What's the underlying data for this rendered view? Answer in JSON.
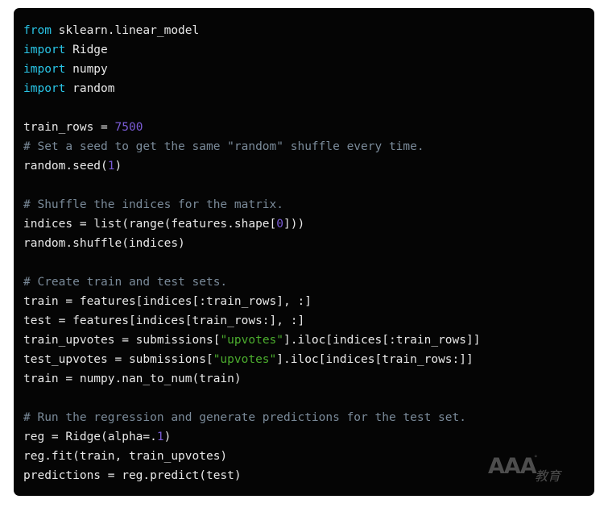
{
  "panel": {
    "background_color": "#050505",
    "language": "python"
  },
  "theme": {
    "background": "#050505",
    "plain_text": "#e8e8e8",
    "keyword": "#29c5e6",
    "number": "#7b5cd6",
    "string": "#4cad2e",
    "comment": "#7a8a99"
  },
  "watermark": {
    "logo_text": "AAA",
    "degree_mark": "°",
    "cjk_text": "教育"
  },
  "code": {
    "lines": [
      [
        {
          "t": "from",
          "c": "kw"
        },
        {
          "t": " sklearn.linear_model",
          "c": "pln"
        }
      ],
      [
        {
          "t": "import",
          "c": "kw"
        },
        {
          "t": " Ridge",
          "c": "pln"
        }
      ],
      [
        {
          "t": "import",
          "c": "kw"
        },
        {
          "t": " numpy",
          "c": "pln"
        }
      ],
      [
        {
          "t": "import",
          "c": "kw"
        },
        {
          "t": " random",
          "c": "pln"
        }
      ],
      [],
      [
        {
          "t": "train_rows = ",
          "c": "pln"
        },
        {
          "t": "7500",
          "c": "num"
        }
      ],
      [
        {
          "t": "# Set a seed to get the same \"random\" shuffle every time.",
          "c": "com"
        }
      ],
      [
        {
          "t": "random.seed(",
          "c": "pln"
        },
        {
          "t": "1",
          "c": "num"
        },
        {
          "t": ")",
          "c": "pln"
        }
      ],
      [],
      [
        {
          "t": "# Shuffle the indices for the matrix.",
          "c": "com"
        }
      ],
      [
        {
          "t": "indices = list(range(features.shape[",
          "c": "pln"
        },
        {
          "t": "0",
          "c": "num"
        },
        {
          "t": "]))",
          "c": "pln"
        }
      ],
      [
        {
          "t": "random.shuffle(indices)",
          "c": "pln"
        }
      ],
      [],
      [
        {
          "t": "# Create train and test sets.",
          "c": "com"
        }
      ],
      [
        {
          "t": "train = features[indices[:train_rows], :]",
          "c": "pln"
        }
      ],
      [
        {
          "t": "test = features[indices[train_rows:], :]",
          "c": "pln"
        }
      ],
      [
        {
          "t": "train_upvotes = submissions[",
          "c": "pln"
        },
        {
          "t": "\"upvotes\"",
          "c": "str"
        },
        {
          "t": "].iloc[indices[:train_rows]]",
          "c": "pln"
        }
      ],
      [
        {
          "t": "test_upvotes = submissions[",
          "c": "pln"
        },
        {
          "t": "\"upvotes\"",
          "c": "str"
        },
        {
          "t": "].iloc[indices[train_rows:]]",
          "c": "pln"
        }
      ],
      [
        {
          "t": "train = numpy.nan_to_num(train)",
          "c": "pln"
        }
      ],
      [],
      [
        {
          "t": "# Run the regression and generate predictions for the test set.",
          "c": "com"
        }
      ],
      [
        {
          "t": "reg = Ridge(alpha=.",
          "c": "pln"
        },
        {
          "t": "1",
          "c": "num"
        },
        {
          "t": ")",
          "c": "pln"
        }
      ],
      [
        {
          "t": "reg.fit(train, train_upvotes)",
          "c": "pln"
        }
      ],
      [
        {
          "t": "predictions = reg.predict(test)",
          "c": "pln"
        }
      ]
    ]
  }
}
